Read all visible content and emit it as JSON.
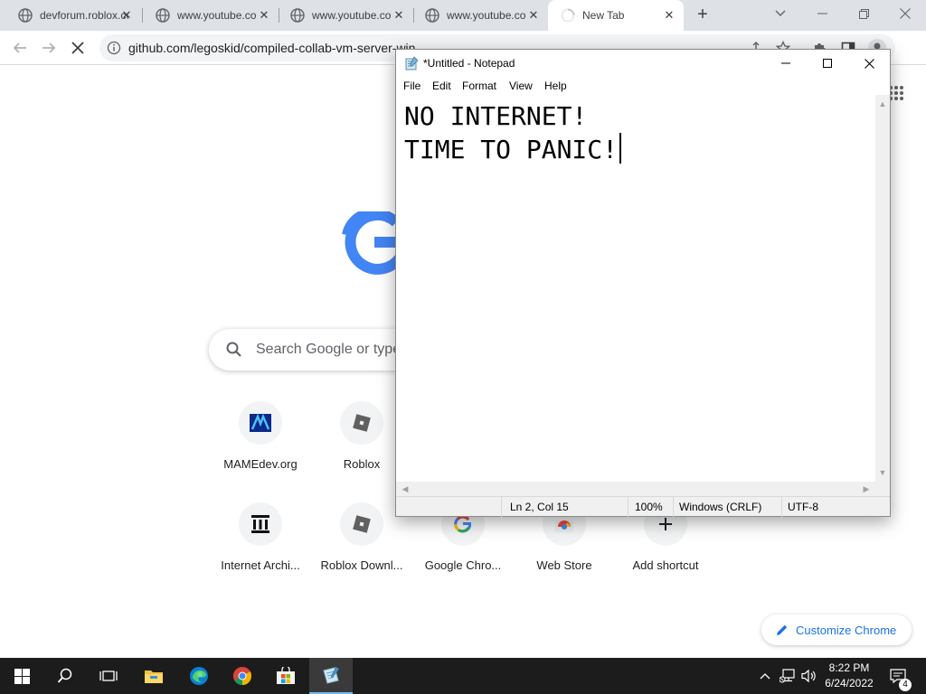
{
  "browser": {
    "tabs": [
      {
        "title": "devforum.roblox.com",
        "active": false
      },
      {
        "title": "www.youtube.com",
        "active": false
      },
      {
        "title": "www.youtube.com",
        "active": false
      },
      {
        "title": "www.youtube.com",
        "active": false
      },
      {
        "title": "New Tab",
        "active": true
      }
    ],
    "address": "github.com/legoskid/compiled-collab-vm-server-win..."
  },
  "ntp": {
    "search_placeholder": "Search Google or type a URL",
    "shortcuts": [
      {
        "label": "MAMEdev.org",
        "icon": "mamedev-icon"
      },
      {
        "label": "Roblox",
        "icon": "roblox-icon"
      },
      {
        "label": "Internet Archi...",
        "icon": "internet-archive-icon"
      },
      {
        "label": "Roblox Downl...",
        "icon": "roblox-icon"
      },
      {
        "label": "Google Chro...",
        "icon": "google-icon"
      },
      {
        "label": "Web Store",
        "icon": "web-store-icon"
      },
      {
        "label": "Add shortcut",
        "icon": "plus-icon"
      }
    ],
    "customize_label": "Customize Chrome"
  },
  "notepad": {
    "title": "*Untitled - Notepad",
    "menu": [
      "File",
      "Edit",
      "Format",
      "View",
      "Help"
    ],
    "text": "NO INTERNET!\nTIME TO PANIC!",
    "status": {
      "position": "Ln 2, Col 15",
      "zoom": "100%",
      "line_ending": "Windows (CRLF)",
      "encoding": "UTF-8"
    }
  },
  "taskbar": {
    "time": "8:22 PM",
    "date": "6/24/2022",
    "notifications": "4",
    "pinned": [
      "windows-start-icon",
      "search-icon",
      "task-view-icon",
      "file-explorer-icon",
      "edge-icon",
      "chrome-icon",
      "store-icon",
      "notepad-icon"
    ]
  }
}
